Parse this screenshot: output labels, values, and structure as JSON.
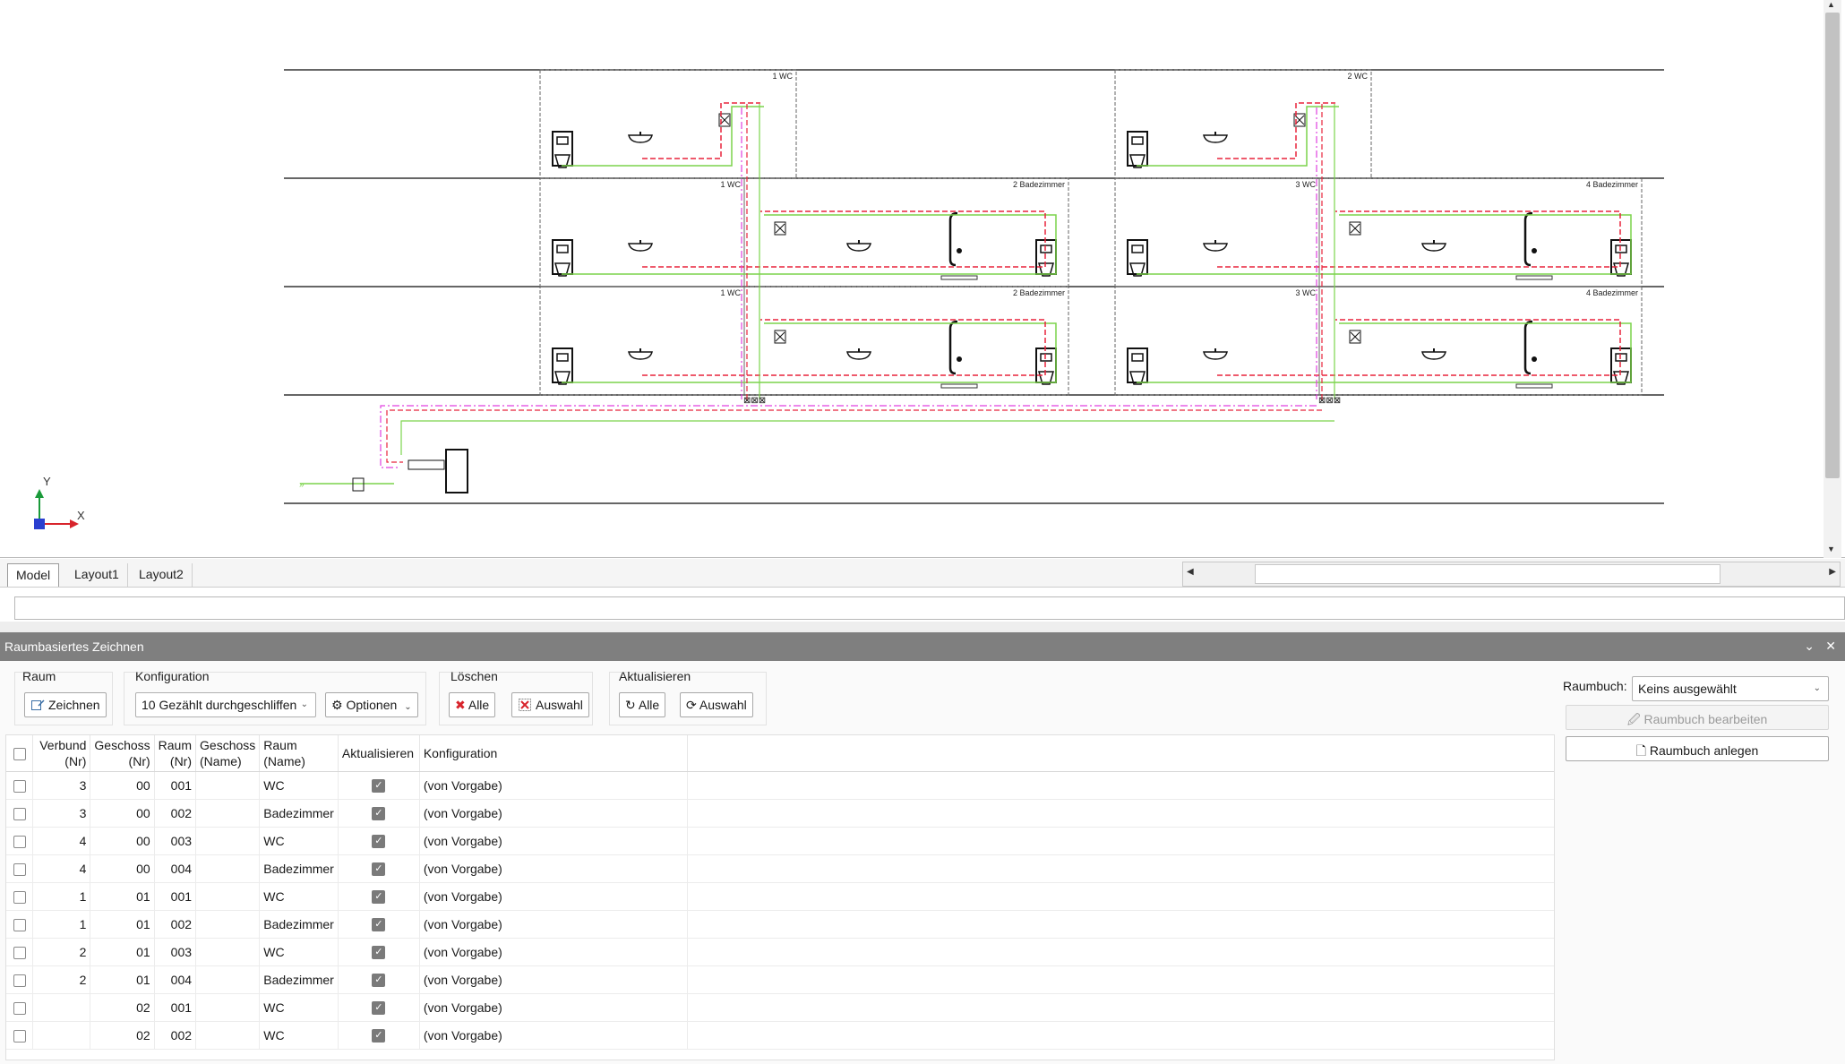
{
  "tabs": {
    "model": "Model",
    "layout1": "Layout1",
    "layout2": "Layout2"
  },
  "drawing": {
    "rooms": [
      {
        "label": "1 WC"
      },
      {
        "label": "2 WC"
      },
      {
        "label": "1 WC"
      },
      {
        "label": "2 Badezimmer"
      },
      {
        "label": "3 WC"
      },
      {
        "label": "4 Badezimmer"
      },
      {
        "label": "1 WC"
      },
      {
        "label": "2 Badezimmer"
      },
      {
        "label": "3 WC"
      },
      {
        "label": "4 Badezimmer"
      }
    ],
    "ucs": {
      "x": "X",
      "y": "Y"
    },
    "colors": {
      "cold": "#7cd44c",
      "hot": "#e8243c",
      "circ": "#e040e0",
      "floor": "#333333"
    }
  },
  "panel": {
    "title": "Raumbasiertes Zeichnen",
    "raum": {
      "label": "Raum",
      "zeichnen": "Zeichnen"
    },
    "konfiguration": {
      "label": "Konfiguration",
      "value": "10 Gezählt durchgeschliffen",
      "optionen": "Optionen"
    },
    "loeschen": {
      "label": "Löschen",
      "alle": "Alle",
      "auswahl": "Auswahl"
    },
    "aktualisieren": {
      "label": "Aktualisieren",
      "alle": "Alle",
      "auswahl": "Auswahl"
    },
    "raumbuch": {
      "label": "Raumbuch:",
      "value": "Keins ausgewählt",
      "bearbeiten": "Raumbuch bearbeiten",
      "anlegen": "Raumbuch anlegen"
    }
  },
  "table": {
    "headers": {
      "verbund": [
        "Verbund",
        "(Nr)"
      ],
      "geschoss_nr": [
        "Geschoss",
        "(Nr)"
      ],
      "raum_nr": [
        "Raum",
        "(Nr)"
      ],
      "geschoss_name": [
        "Geschoss",
        "(Name)"
      ],
      "raum_name": [
        "Raum",
        "(Name)"
      ],
      "aktualisieren": "Aktualisieren",
      "konfiguration": "Konfiguration"
    },
    "rows": [
      {
        "verbund": "3",
        "geschoss": "00",
        "raum": "001",
        "gname": "",
        "rname": "WC",
        "akt": true,
        "konf": "(von Vorgabe)"
      },
      {
        "verbund": "3",
        "geschoss": "00",
        "raum": "002",
        "gname": "",
        "rname": "Badezimmer",
        "akt": true,
        "konf": "(von Vorgabe)"
      },
      {
        "verbund": "4",
        "geschoss": "00",
        "raum": "003",
        "gname": "",
        "rname": "WC",
        "akt": true,
        "konf": "(von Vorgabe)"
      },
      {
        "verbund": "4",
        "geschoss": "00",
        "raum": "004",
        "gname": "",
        "rname": "Badezimmer",
        "akt": true,
        "konf": "(von Vorgabe)"
      },
      {
        "verbund": "1",
        "geschoss": "01",
        "raum": "001",
        "gname": "",
        "rname": "WC",
        "akt": true,
        "konf": "(von Vorgabe)"
      },
      {
        "verbund": "1",
        "geschoss": "01",
        "raum": "002",
        "gname": "",
        "rname": "Badezimmer",
        "akt": true,
        "konf": "(von Vorgabe)"
      },
      {
        "verbund": "2",
        "geschoss": "01",
        "raum": "003",
        "gname": "",
        "rname": "WC",
        "akt": true,
        "konf": "(von Vorgabe)"
      },
      {
        "verbund": "2",
        "geschoss": "01",
        "raum": "004",
        "gname": "",
        "rname": "Badezimmer",
        "akt": true,
        "konf": "(von Vorgabe)"
      },
      {
        "verbund": "",
        "geschoss": "02",
        "raum": "001",
        "gname": "",
        "rname": "WC",
        "akt": true,
        "konf": "(von Vorgabe)"
      },
      {
        "verbund": "",
        "geschoss": "02",
        "raum": "002",
        "gname": "",
        "rname": "WC",
        "akt": true,
        "konf": "(von Vorgabe)"
      }
    ]
  }
}
